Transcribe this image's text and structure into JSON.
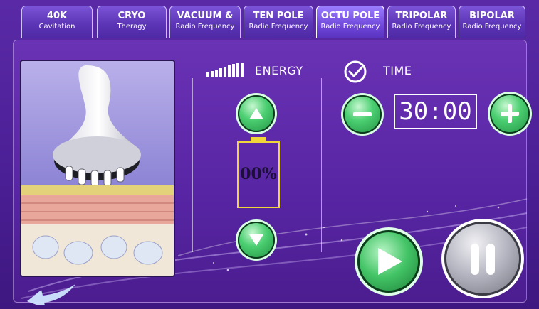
{
  "tabs": [
    {
      "title": "40K",
      "subtitle": "Cavitation"
    },
    {
      "title": "CRYO",
      "subtitle": "Theragy"
    },
    {
      "title": "VACUUM &",
      "subtitle": "Radio Frequency"
    },
    {
      "title": "TEN POLE",
      "subtitle": "Radio Frequency"
    },
    {
      "title": "OCTU POLE",
      "subtitle": "Radio Frequency"
    },
    {
      "title": "TRIPOLAR",
      "subtitle": "Radio Frequency"
    },
    {
      "title": "BIPOLAR",
      "subtitle": "Radio Frequency"
    }
  ],
  "active_tab": 4,
  "energy": {
    "label": "ENERGY",
    "value_text": "00%",
    "level_fraction": 0
  },
  "time": {
    "label": "TIME",
    "value": "30:00"
  },
  "colors": {
    "accent_green": "#3fc463",
    "battery_yellow": "#f1d63a",
    "background_purple": "#5725a3"
  },
  "icons": {
    "signal": "signal-bars-icon",
    "check": "check-circle-icon",
    "up": "triangle-up-icon",
    "down": "triangle-down-icon",
    "minus": "minus-icon",
    "plus": "plus-icon",
    "play": "play-icon",
    "pause": "pause-icon",
    "back": "back-arrow-icon"
  }
}
